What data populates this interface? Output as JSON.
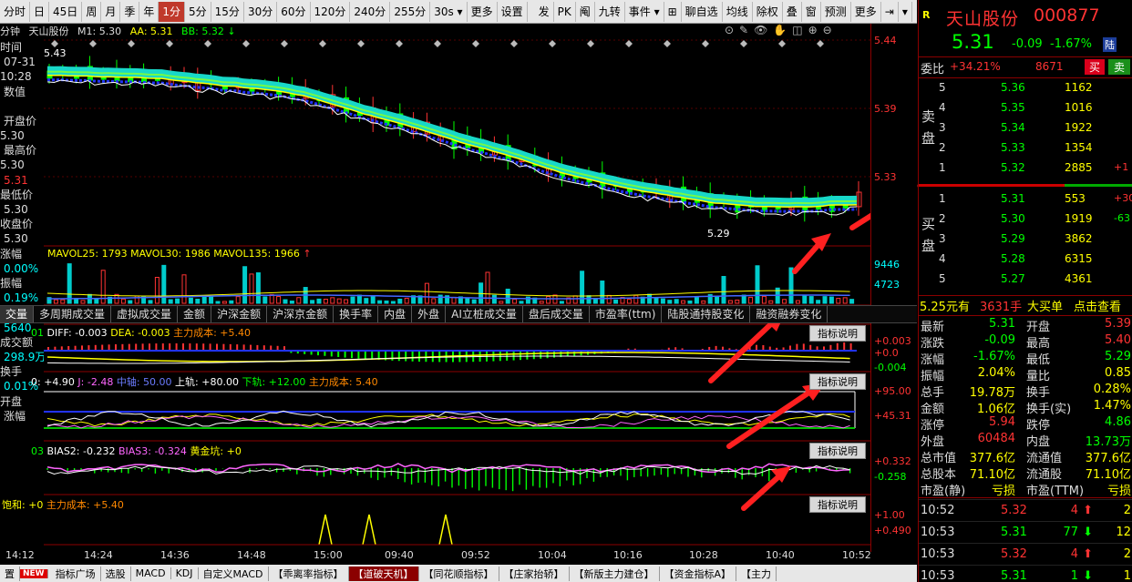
{
  "toolbar": {
    "items": [
      "分时",
      "日",
      "45日",
      "周",
      "月",
      "季",
      "年",
      "1分",
      "5分",
      "15分",
      "30分",
      "60分",
      "120分",
      "240分",
      "255分",
      "30s ▾",
      "更多",
      "设置",
      "发",
      "PK",
      "阄",
      "九转",
      "事件 ▾",
      "⊞",
      "聊自选",
      "均线",
      "除权",
      "叠",
      "窗",
      "预测",
      "更多",
      "⇥",
      "▾"
    ],
    "active_index": 7
  },
  "title_bar": {
    "prefix": "分钟",
    "name": "天山股份",
    "m1": "M1: 5.30",
    "aa": "AA: 5.31",
    "bb": "BB: 5.32",
    "high_mark": "5.43",
    "low_mark": "5.29"
  },
  "left_panel": {
    "items": [
      "时间",
      "07-31",
      "10:28",
      "数值",
      "",
      "开盘价",
      "5.30",
      "最高价",
      "5.30",
      "5.31",
      "最低价",
      "5.30",
      "收盘价",
      "5.30",
      "涨幅",
      "0.00%",
      "振幅",
      "0.19%",
      "成交量",
      "5640",
      "成交额",
      "298.9万",
      "换手",
      "0.01%",
      "开盘",
      "涨幅"
    ]
  },
  "price_axis": [
    "5.44",
    "5.39",
    "5.33"
  ],
  "vol": {
    "label": "MAVOL25: 1793  MAVOL30: 1986  MAVOL135: 1966",
    "axis": [
      "9446",
      "4723"
    ]
  },
  "indicator_tabs": [
    "交量",
    "多周期成交量",
    "虚拟成交量",
    "金额",
    "沪深金额",
    "沪深京金额",
    "换手率",
    "内盘",
    "外盘",
    "AI立桩成交量",
    "盘后成交量",
    "市盈率(ttm)",
    "陆股通持股变化",
    "融资融券变化"
  ],
  "macd": {
    "label_prefix": "01",
    "diff": "DIFF: -0.003",
    "dea": "DEA: -0.003",
    "cost": "主力成本: +5.40",
    "axis": [
      "+0.003",
      "+0.0",
      "-0.004"
    ]
  },
  "kdj": {
    "label_prefix": "0: +4.90",
    "j": "J: -2.48",
    "mid": "中轴: 50.00",
    "upper": "上轨: +80.00",
    "lower": "下轨: +12.00",
    "cost": "主力成本: 5.40",
    "axis": [
      "+95.00",
      "+45.31"
    ]
  },
  "bias": {
    "label_prefix": "03",
    "b2": "BIAS2: -0.232",
    "b3": "BIAS3: -0.324",
    "gold": "黄金坑: +0",
    "axis": [
      "+0.332",
      "-0.258"
    ]
  },
  "sat": {
    "label": "饱和: +0",
    "cost": "主力成本: +5.40",
    "axis": [
      "+1.00",
      "+0.490"
    ]
  },
  "ind_btn": "指标说明",
  "time_axis": [
    "14:12",
    "14:24",
    "14:36",
    "14:48",
    "15:00",
    "09:40",
    "09:52",
    "10:04",
    "10:16",
    "10:28",
    "10:40",
    "10:52"
  ],
  "bottom_bar": [
    "置",
    "NEW",
    "指标广场",
    "选股",
    "MACD",
    "KDJ",
    "自定义MACD",
    "【乖离率指标】",
    "【道破天机】",
    "【同花顺指标】",
    "【庄家抬轿】",
    "【新版主力建仓】",
    "【资金指标A】",
    "【主力"
  ],
  "bottom_active": 8,
  "quote": {
    "tag": "R",
    "name": "天山股份",
    "code": "000877",
    "price": "5.31",
    "change": "-0.09",
    "pct": "-1.67%",
    "lu": "陆",
    "weibi_label": "委比",
    "weibi": "+34.21%",
    "weicha": "8671",
    "buy_btn": "买",
    "sell_btn": "卖",
    "sell_label": "卖\n盘",
    "buy_label": "买\n盘",
    "asks": [
      {
        "level": "5",
        "price": "5.36",
        "vol": "1162"
      },
      {
        "level": "4",
        "price": "5.35",
        "vol": "1016"
      },
      {
        "level": "3",
        "price": "5.34",
        "vol": "1922"
      },
      {
        "level": "2",
        "price": "5.33",
        "vol": "1354"
      },
      {
        "level": "1",
        "price": "5.32",
        "vol": "2885",
        "extra": "+1"
      }
    ],
    "bids": [
      {
        "level": "1",
        "price": "5.31",
        "vol": "553",
        "extra": "+30"
      },
      {
        "level": "2",
        "price": "5.30",
        "vol": "1919",
        "extra": "-63"
      },
      {
        "level": "3",
        "price": "5.29",
        "vol": "3862",
        "extra": ""
      },
      {
        "level": "4",
        "price": "5.28",
        "vol": "6315",
        "extra": ""
      },
      {
        "level": "5",
        "price": "5.27",
        "vol": "4361",
        "extra": ""
      }
    ],
    "big_order": {
      "price": "5.25元有",
      "vol": "3631手",
      "text": "大买单",
      "link": "点击查看"
    },
    "stats": [
      [
        "最新",
        "5.31",
        "开盘",
        "5.39"
      ],
      [
        "涨跌",
        "-0.09",
        "最高",
        "5.40"
      ],
      [
        "涨幅",
        "-1.67%",
        "最低",
        "5.29"
      ],
      [
        "振幅",
        "2.04%",
        "量比",
        "0.85"
      ],
      [
        "总手",
        "19.78万",
        "换手",
        "0.28%"
      ],
      [
        "金额",
        "1.06亿",
        "换手(实)",
        "1.47%"
      ],
      [
        "涨停",
        "5.94",
        "跌停",
        "4.86"
      ],
      [
        "外盘",
        "60484",
        "内盘",
        "13.73万"
      ],
      [
        "总市值",
        "377.6亿",
        "流通值",
        "377.6亿"
      ],
      [
        "总股本",
        "71.10亿",
        "流通股",
        "71.10亿"
      ],
      [
        "市盈(静)",
        "亏损",
        "市盈(TTM)",
        "亏损"
      ]
    ],
    "trades": [
      {
        "time": "10:52",
        "price": "5.32",
        "vol": "4",
        "dir": "up",
        "n": "2"
      },
      {
        "time": "10:53",
        "price": "5.31",
        "vol": "77",
        "dir": "down",
        "n": "12"
      },
      {
        "time": "10:53",
        "price": "5.32",
        "vol": "4",
        "dir": "up",
        "n": "2"
      },
      {
        "time": "10:53",
        "price": "5.31",
        "vol": "1",
        "dir": "down",
        "n": "1"
      }
    ]
  },
  "colors": {
    "up": "#ff3333",
    "down": "#00ff00",
    "accent": "#ffff00",
    "border": "#8b0000",
    "arrow": "#ff2020"
  }
}
